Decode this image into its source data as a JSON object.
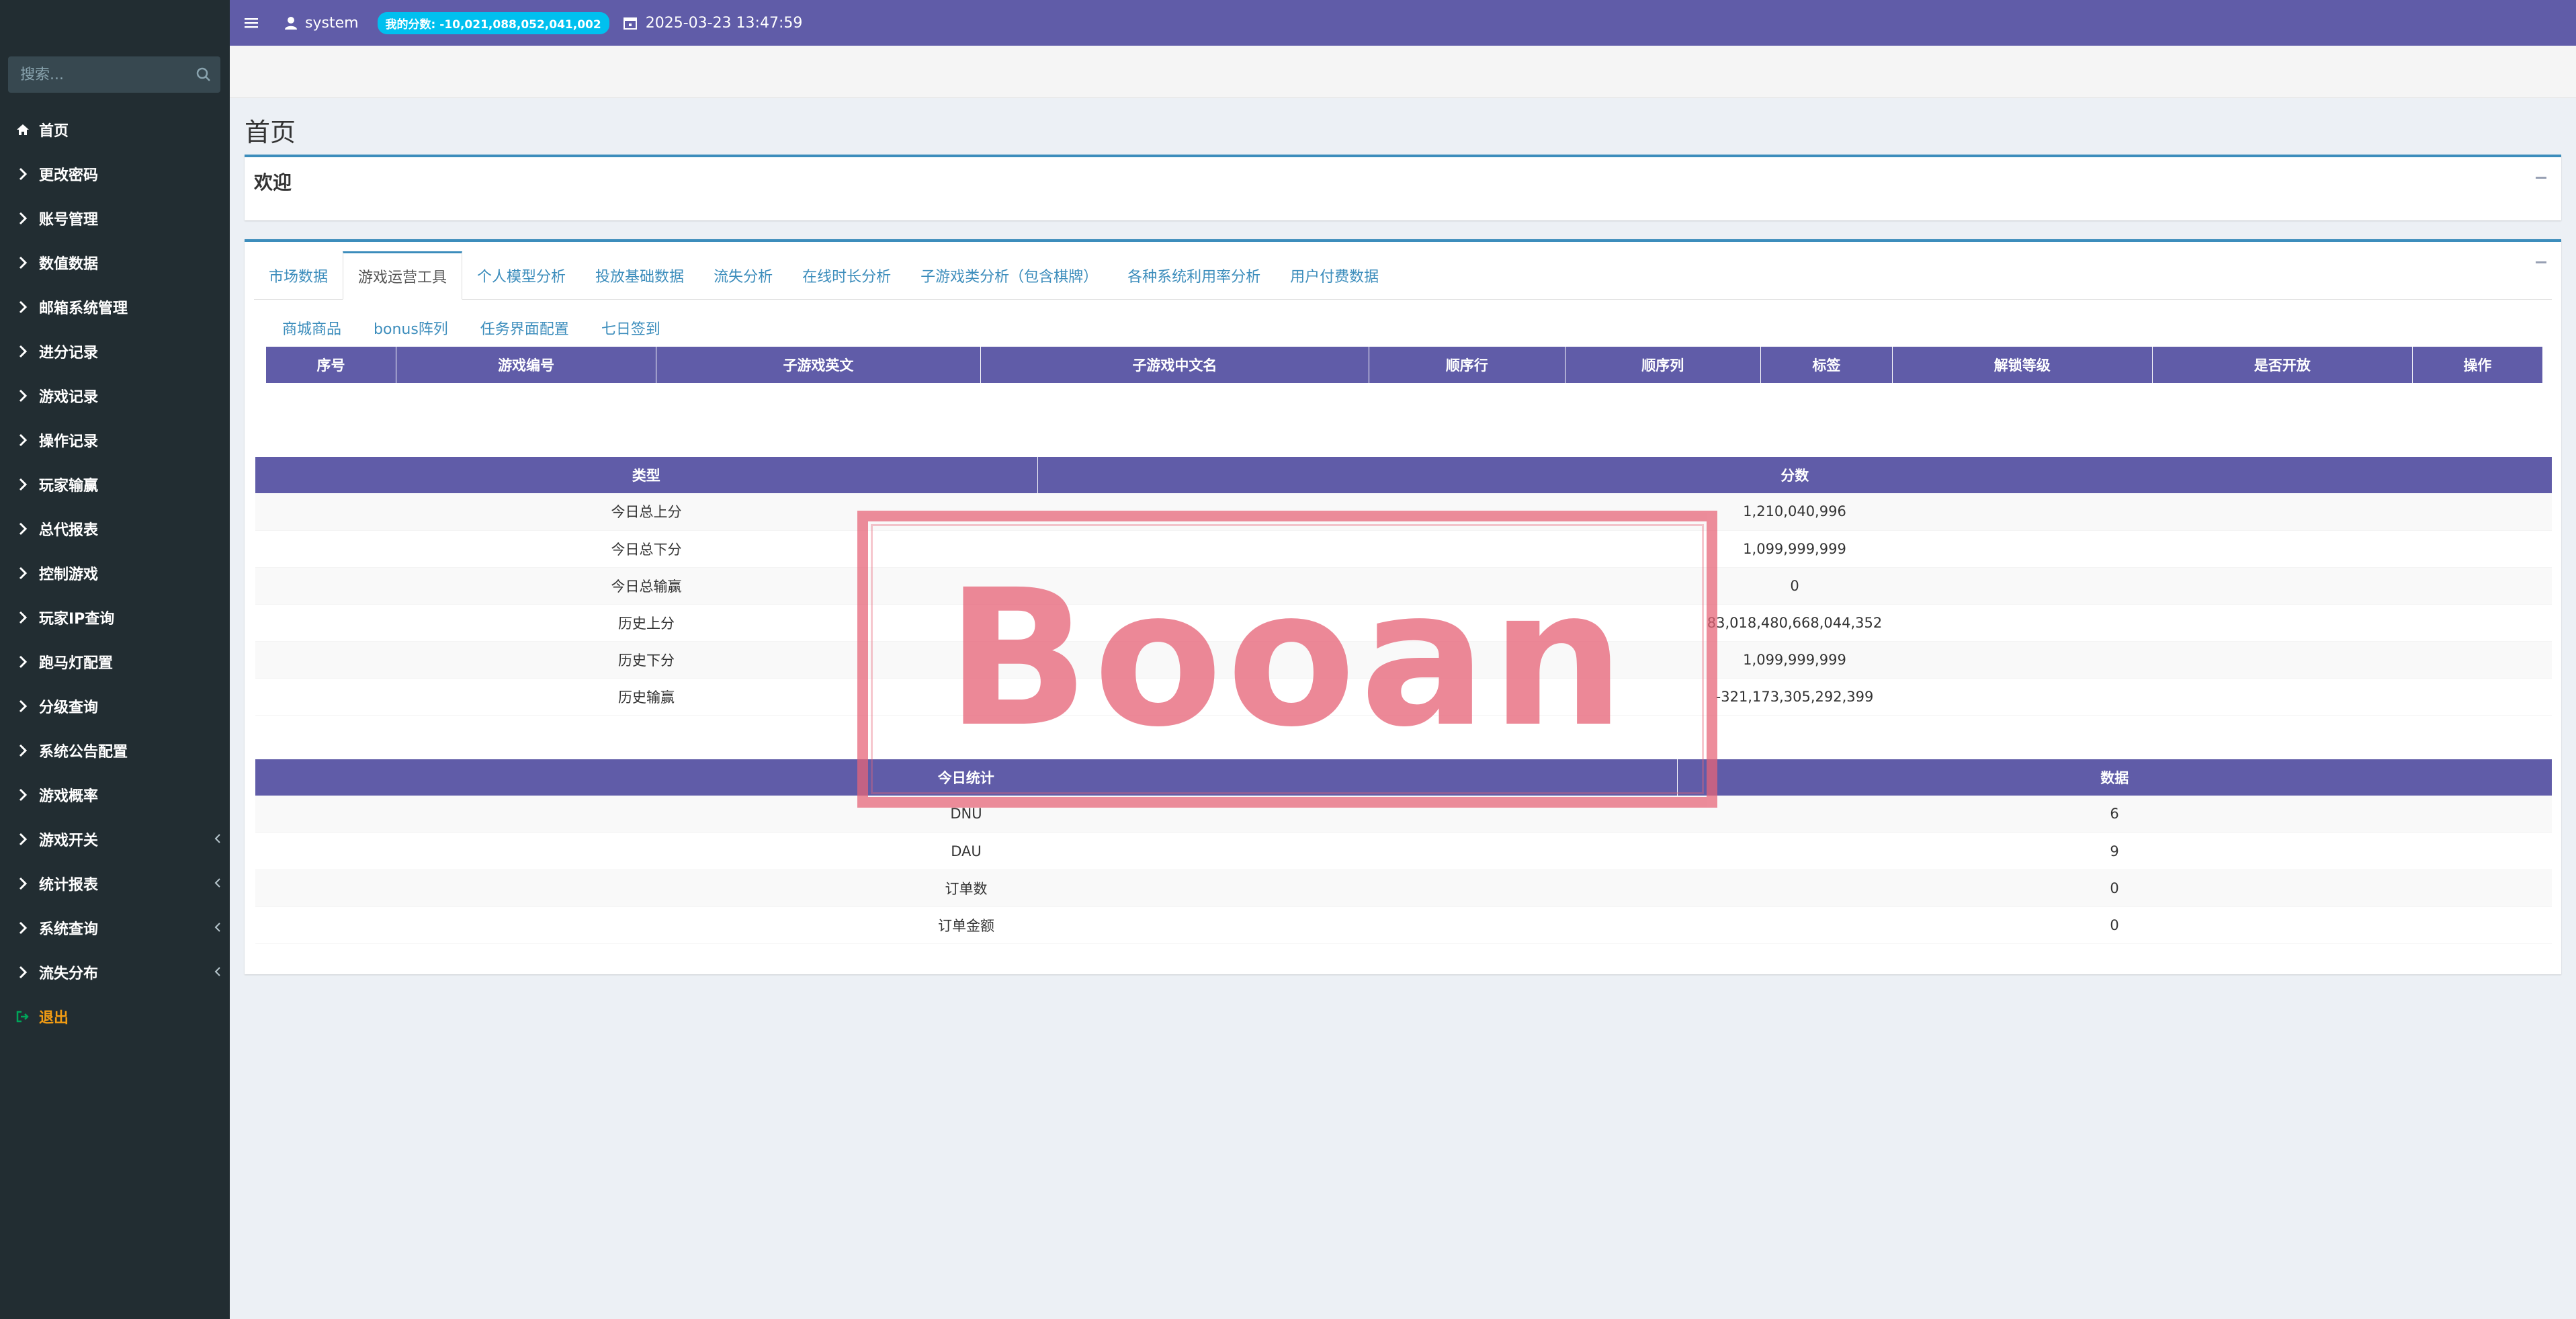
{
  "header": {
    "username": "system",
    "score_badge": "我的分数: -10,021,088,052,041,002",
    "datetime": "2025-03-23 13:47:59"
  },
  "sidebar": {
    "search_placeholder": "搜索...",
    "items": [
      {
        "label": "首页",
        "icon": "home-icon",
        "caret": false
      },
      {
        "label": "更改密码",
        "icon": "chevron-right-icon",
        "caret": false
      },
      {
        "label": "账号管理",
        "icon": "chevron-right-icon",
        "caret": false
      },
      {
        "label": "数值数据",
        "icon": "chevron-right-icon",
        "caret": false
      },
      {
        "label": "邮箱系统管理",
        "icon": "chevron-right-icon",
        "caret": false
      },
      {
        "label": "进分记录",
        "icon": "chevron-right-icon",
        "caret": false
      },
      {
        "label": "游戏记录",
        "icon": "chevron-right-icon",
        "caret": false
      },
      {
        "label": "操作记录",
        "icon": "chevron-right-icon",
        "caret": false
      },
      {
        "label": "玩家输赢",
        "icon": "chevron-right-icon",
        "caret": false
      },
      {
        "label": "总代报表",
        "icon": "chevron-right-icon",
        "caret": false
      },
      {
        "label": "控制游戏",
        "icon": "chevron-right-icon",
        "caret": false
      },
      {
        "label": "玩家IP查询",
        "icon": "chevron-right-icon",
        "caret": false
      },
      {
        "label": "跑马灯配置",
        "icon": "chevron-right-icon",
        "caret": false
      },
      {
        "label": "分级查询",
        "icon": "chevron-right-icon",
        "caret": false
      },
      {
        "label": "系统公告配置",
        "icon": "chevron-right-icon",
        "caret": false
      },
      {
        "label": "游戏概率",
        "icon": "chevron-right-icon",
        "caret": false
      },
      {
        "label": "游戏开关",
        "icon": "chevron-right-icon",
        "caret": true
      },
      {
        "label": "统计报表",
        "icon": "chevron-right-icon",
        "caret": true
      },
      {
        "label": "系统查询",
        "icon": "chevron-right-icon",
        "caret": true
      },
      {
        "label": "流失分布",
        "icon": "chevron-right-icon",
        "caret": true
      }
    ],
    "logout_label": "退出"
  },
  "page": {
    "title": "首页",
    "welcome_title": "欢迎"
  },
  "tabs": [
    "市场数据",
    "游戏运营工具",
    "个人模型分析",
    "投放基础数据",
    "流失分析",
    "在线时长分析",
    "子游戏类分析（包含棋牌）",
    "各种系统利用率分析",
    "用户付费数据"
  ],
  "active_tab": 1,
  "subtabs": [
    "商城商品",
    "bonus阵列",
    "任务界面配置",
    "七日签到"
  ],
  "game_table": {
    "headers": [
      "序号",
      "游戏编号",
      "子游戏英文",
      "子游戏中文名",
      "顺序行",
      "顺序列",
      "标签",
      "解锁等级",
      "是否开放",
      "操作"
    ]
  },
  "score_table": {
    "headers": [
      "类型",
      "分数"
    ],
    "rows": [
      [
        "今日总上分",
        "1,210,040,996"
      ],
      [
        "今日总下分",
        "1,099,999,999"
      ],
      [
        "今日总输赢",
        "0"
      ],
      [
        "历史上分",
        "83,018,480,668,044,352"
      ],
      [
        "历史下分",
        "1,099,999,999"
      ],
      [
        "历史输赢",
        "-321,173,305,292,399"
      ]
    ]
  },
  "daily_table": {
    "headers": [
      "今日统计",
      "数据"
    ],
    "rows": [
      [
        "DNU",
        "6"
      ],
      [
        "DAU",
        "9"
      ],
      [
        "订单数",
        "0"
      ],
      [
        "订单金额",
        "0"
      ]
    ]
  },
  "stamp": {
    "text": "Booan",
    "color": "#e66478"
  },
  "colors": {
    "header": "#605ca8",
    "sidebar": "#222d32",
    "accent": "#3c8dbc",
    "badge": "#00c0ef",
    "logout": "#f39c12"
  }
}
